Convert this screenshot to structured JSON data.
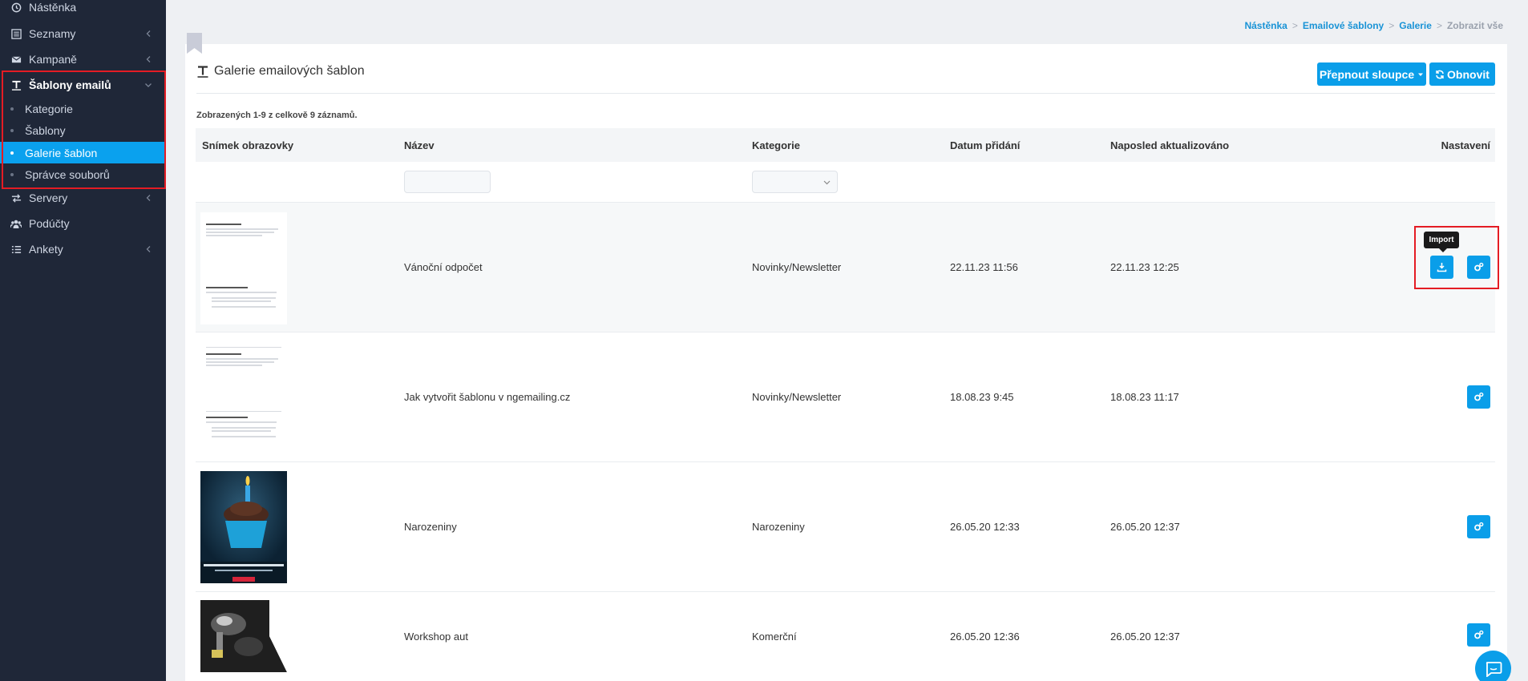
{
  "sidebar": {
    "items": [
      {
        "label": "Nástěnka",
        "icon": "clock-icon"
      },
      {
        "label": "Seznamy",
        "icon": "list-icon"
      },
      {
        "label": "Kampaně",
        "icon": "envelope-icon"
      },
      {
        "label": "Šablony emailů",
        "icon": "text-icon"
      },
      {
        "label": "Servery",
        "icon": "exchange-icon"
      },
      {
        "label": "Podúčty",
        "icon": "users-icon"
      },
      {
        "label": "Ankety",
        "icon": "list-icon"
      }
    ],
    "subitems": [
      {
        "label": "Kategorie"
      },
      {
        "label": "Šablony"
      },
      {
        "label": "Galerie šablon"
      },
      {
        "label": "Správce souborů"
      }
    ]
  },
  "breadcrumb": {
    "items": [
      "Nástěnka",
      "Emailové šablony",
      "Galerie"
    ],
    "current": "Zobrazit vše",
    "separator": ">"
  },
  "panel": {
    "title": "Galerie emailových šablon",
    "toggle_columns_label": "Přepnout sloupce",
    "refresh_label": "Obnovit",
    "count_text": "Zobrazených 1-9 z celkově 9 záznamů."
  },
  "table": {
    "headers": [
      "Snímek obrazovky",
      "Název",
      "Kategorie",
      "Datum přidání",
      "Naposled aktualizováno",
      "Nastavení"
    ],
    "rows": [
      {
        "name": "Vánoční odpočet",
        "category": "Novinky/Newsletter",
        "added": "22.11.23 11:56",
        "updated": "22.11.23 12:25"
      },
      {
        "name": "Jak vytvořit šablonu v ngemailing.cz",
        "category": "Novinky/Newsletter",
        "added": "18.08.23 9:45",
        "updated": "18.08.23 11:17"
      },
      {
        "name": "Narozeniny",
        "category": "Narozeniny",
        "added": "26.05.20 12:33",
        "updated": "26.05.20 12:37"
      },
      {
        "name": "Workshop aut",
        "category": "Komerční",
        "added": "26.05.20 12:36",
        "updated": "26.05.20 12:37"
      }
    ]
  },
  "tooltip": {
    "label": "Import"
  },
  "colors": {
    "accent": "#0a9ee9",
    "sidebar_bg": "#1f2738",
    "highlight": "#e41c24"
  }
}
